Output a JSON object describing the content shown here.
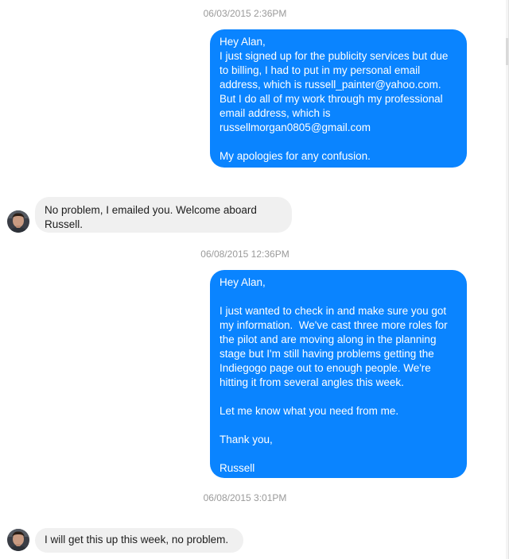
{
  "messages": [
    {
      "type": "timestamp",
      "text": "06/03/2015 2:36PM"
    },
    {
      "type": "outgoing",
      "text": "Hey Alan,\nI just signed up for the publicity services but due to billing, I had to put in my personal email address, which is russell_painter@yahoo.com. But I do all of my work through my professional email address, which is russellmorgan0805@gmail.com\n\nMy apologies for any confusion."
    },
    {
      "type": "incoming",
      "text": "No problem, I emailed you. Welcome aboard Russell.",
      "avatar_icon": "user-avatar"
    },
    {
      "type": "timestamp",
      "text": "06/08/2015 12:36PM"
    },
    {
      "type": "outgoing",
      "text": "Hey Alan,\n\nI just wanted to check in and make sure you got my information.  We've cast three more roles for the pilot and are moving along in the planning stage but I'm still having problems getting the Indiegogo page out to enough people. We're hitting it from several angles this week.\n\nLet me know what you need from me.\n\nThank you,\n\nRussell"
    },
    {
      "type": "timestamp",
      "text": "06/08/2015 3:01PM"
    },
    {
      "type": "incoming",
      "text": "I will get this up this week, no problem.",
      "avatar_icon": "user-avatar"
    }
  ],
  "colors": {
    "outgoing_bubble": "#0a84ff",
    "incoming_bubble": "#f0f0f0",
    "timestamp_text": "#9a9a9a"
  }
}
